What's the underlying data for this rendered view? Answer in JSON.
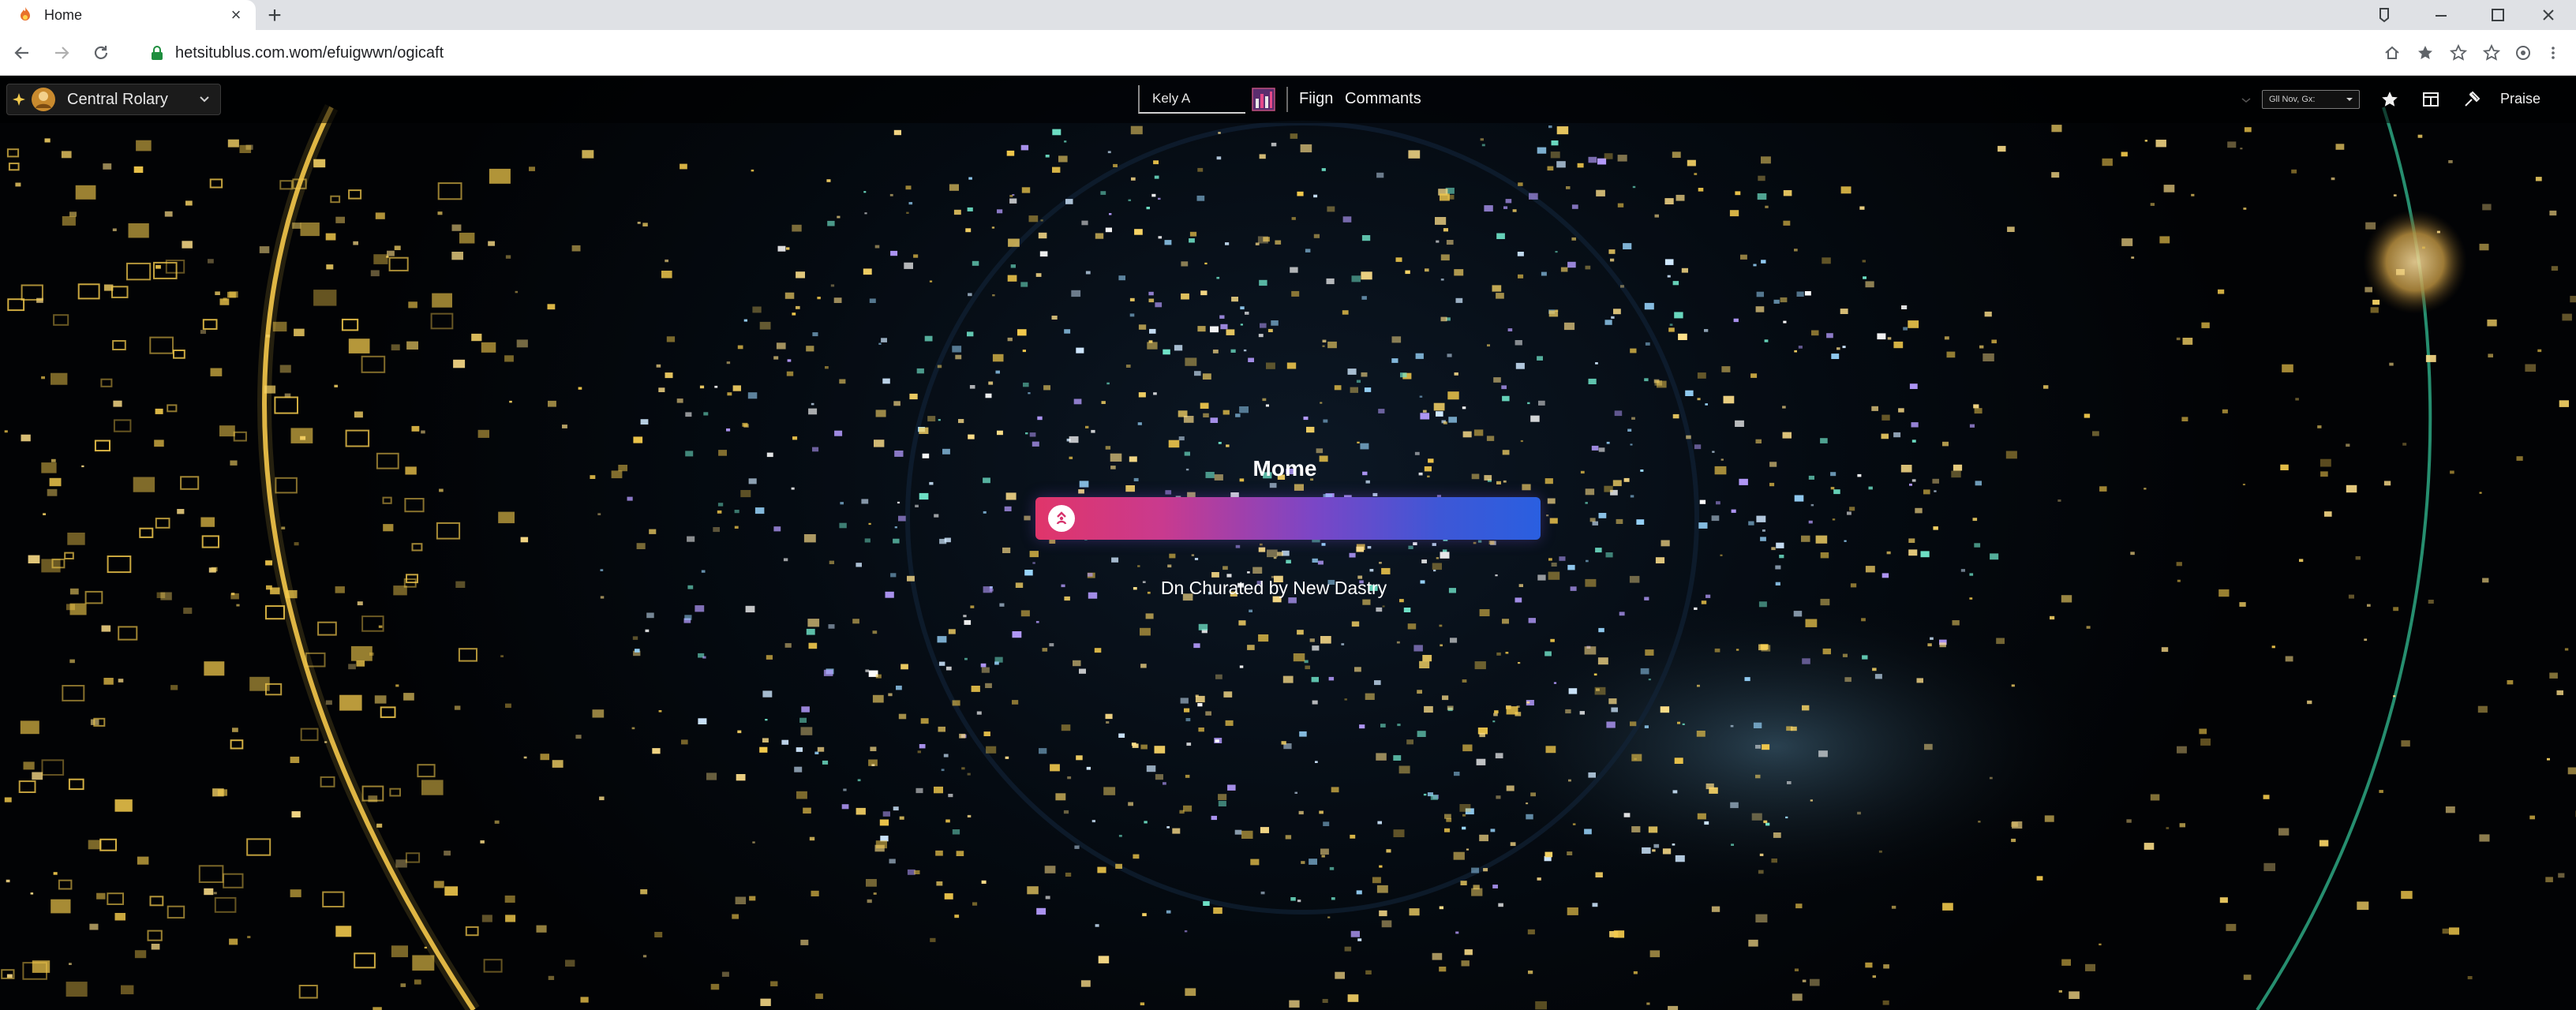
{
  "browser": {
    "tab_title": "Home",
    "new_tab_symbol": "+",
    "url": "hetsitublus.com.wom/efuigwwn/ogicaft",
    "tab_icon": "flame-favicon-icon",
    "window_icons": [
      "download-icon",
      "minimize-icon",
      "maximize-icon",
      "close-icon"
    ],
    "toolbar_icons": [
      "home-icon",
      "bookmark-star-icon",
      "star-outline-icon",
      "star-outline-icon",
      "extension-icon",
      "menu-icon"
    ]
  },
  "appbar": {
    "brand_name": "Central Rolary",
    "user_field_value": "Kely A",
    "nav_links": [
      "Fiign",
      "Commants"
    ],
    "locale_select_value": "Gll Nov, Gx:",
    "praise_label": "Praise",
    "icons": [
      "bar-chart-icon",
      "star-icon",
      "layout-icon",
      "gavel-icon"
    ]
  },
  "hero": {
    "title": "Mome",
    "subtitle": "Dn Churated by New Dastry"
  },
  "colors": {
    "bar_start": "#e0356a",
    "bar_end": "#2a5fe0",
    "page_bg": "#050b12",
    "gold": "#f2c94c"
  }
}
